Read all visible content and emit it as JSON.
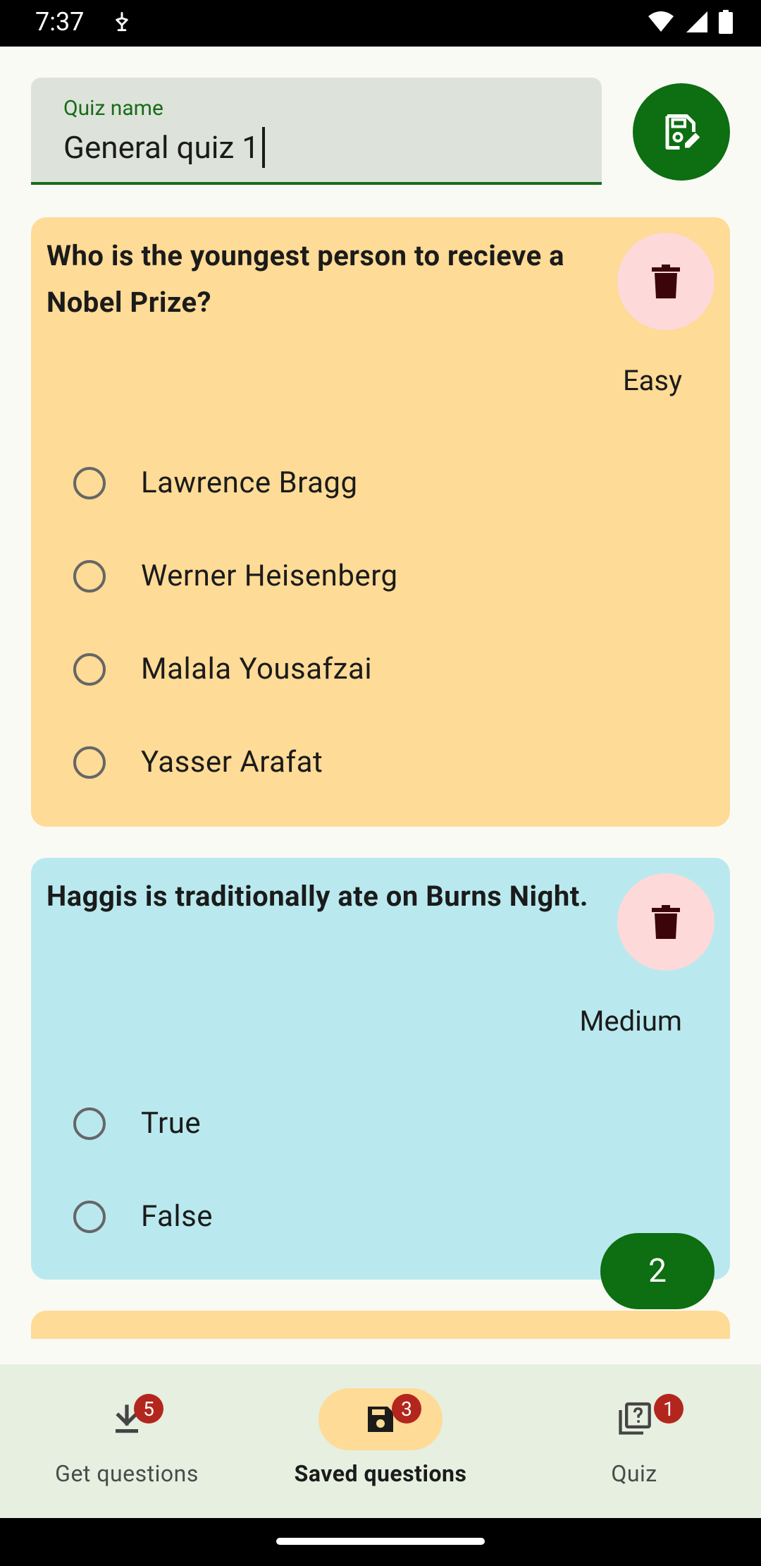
{
  "status_bar": {
    "time": "7:37"
  },
  "quiz_name": {
    "label": "Quiz name",
    "value": "General quiz 1"
  },
  "questions": [
    {
      "text": "Who is the youngest person to recieve a Nobel Prize?",
      "difficulty": "Easy",
      "color": "#fedb96",
      "options": [
        "Lawrence Bragg",
        "Werner Heisenberg",
        "Malala Yousafzai",
        "Yasser Arafat"
      ]
    },
    {
      "text": "Haggis is traditionally ate on Burns Night.",
      "difficulty": "Medium",
      "color": "#b9e9ee",
      "options": [
        "True",
        "False"
      ]
    }
  ],
  "count_pill": "2",
  "nav": [
    {
      "label": "Get questions",
      "badge": "5",
      "icon": "download-icon"
    },
    {
      "label": "Saved questions",
      "badge": "3",
      "icon": "save-icon",
      "active": true
    },
    {
      "label": "Quiz",
      "badge": "1",
      "icon": "quiz-icon"
    }
  ],
  "colors": {
    "primary": "#0d6e12",
    "delete_bg": "#fdd9d9",
    "badge": "#b3261e"
  }
}
